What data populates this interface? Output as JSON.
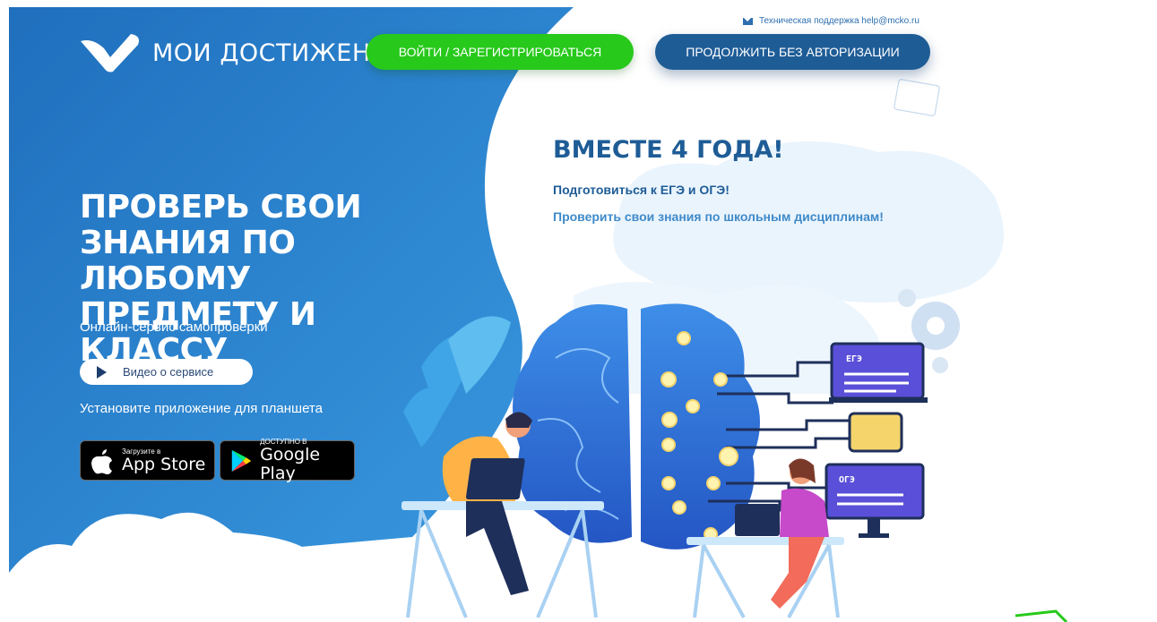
{
  "header": {
    "brand": "МОИ ДОСТИЖЕНИЯ",
    "login_button": "ВОЙТИ / ЗАРЕГИСТРИРОВАТЬСЯ",
    "continue_button": "ПРОДОЛЖИТЬ БЕЗ АВТОРИЗАЦИИ",
    "support_text": "Техническая поддержка help@mcko.ru"
  },
  "hero": {
    "title": "ПРОВЕРЬ СВОИ ЗНАНИЯ ПО ЛЮБОМУ ПРЕДМЕТУ И КЛАССУ",
    "subtitle": "Онлайн-сервис самопроверки",
    "video_button": "Видео о сервисе",
    "install_text": "Установите приложение для планшета"
  },
  "stores": {
    "appstore_small": "Загрузите в",
    "appstore_big": "App Store",
    "googleplay_small": "ДОСТУПНО В",
    "googleplay_big": "Google Play"
  },
  "promo": {
    "headline": "ВМЕСТЕ 4 ГОДА!",
    "line1": "Подготовиться к ЕГЭ и ОГЭ!",
    "line2": "Проверить свои знания по школьным дисциплинам!"
  },
  "illustration": {
    "monitor_top_label": "ЕГЭ",
    "monitor_bottom_label": "ОГЭ"
  },
  "colors": {
    "brand_blue": "#1e5c96",
    "hero_blue": "#2a82cf",
    "login_green": "#27c91b",
    "accent_light_blue": "#3f8ac9"
  }
}
